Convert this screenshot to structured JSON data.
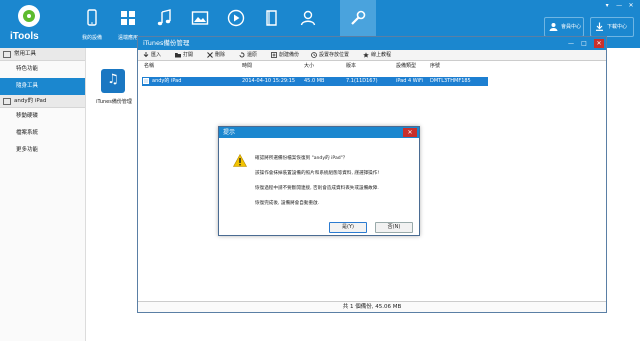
{
  "app": {
    "logo_text": "iTools"
  },
  "topnav": [
    {
      "label": "我的設備",
      "icon": "phone-icon"
    },
    {
      "label": "遠端應用",
      "icon": "apps-grid-icon"
    },
    {
      "label": "",
      "icon": "music-note-icon"
    },
    {
      "label": "",
      "icon": "photo-icon"
    },
    {
      "label": "",
      "icon": "video-play-icon"
    },
    {
      "label": "",
      "icon": "book-icon"
    },
    {
      "label": "",
      "icon": "user-icon"
    },
    {
      "label": "",
      "icon": "wrench-icon"
    }
  ],
  "window_controls": [
    "▾",
    "—",
    "✕"
  ],
  "top_buttons": {
    "member": "會員中心",
    "download": "下載中心"
  },
  "sidebar": {
    "section1": "常用工具",
    "section1_items": [
      "特色功能",
      "隨身工具"
    ],
    "section2": "andy的 iPad",
    "section2_items": [
      "移動硬碟",
      "檔案系統",
      "更多功能"
    ]
  },
  "content": {
    "itunes_label": "iTunes備份管理"
  },
  "backup_manager": {
    "title": "iTunes備份管理",
    "toolbar": [
      "匯入",
      "打開",
      "刪除",
      "還原",
      "創建備份",
      "設置存放位置",
      "線上教程"
    ],
    "columns": [
      "名稱",
      "時間",
      "大小",
      "版本",
      "設備類型",
      "序號"
    ],
    "row": {
      "name": "andy的 iPad",
      "time": "2014-04-10 15:29:15",
      "size": "45.0 MB",
      "version": "7.1(11D167)",
      "device": "iPad 4 WiFi",
      "serial": "DMTL3THMF185"
    },
    "footer": "共 1 個備份, 45.06 MB"
  },
  "dialog": {
    "title": "提示",
    "lines": [
      "確認將所選備份檔案恢復到 \"andy的 iPad\"？",
      "該操作會抹掉裝置設備的照片和系統組態等資料, 謹選擇操作!",
      "恢復過程中請不要斷開連接, 否則會造成資料丟失或設備故障.",
      "恢復完成後, 設備將會自動重啟."
    ],
    "yes": "是(Y)",
    "no": "否(N)"
  },
  "colors": {
    "brand_blue": "#1b87cf",
    "close_red": "#c9302c",
    "selection_blue": "#1d7fd1"
  }
}
